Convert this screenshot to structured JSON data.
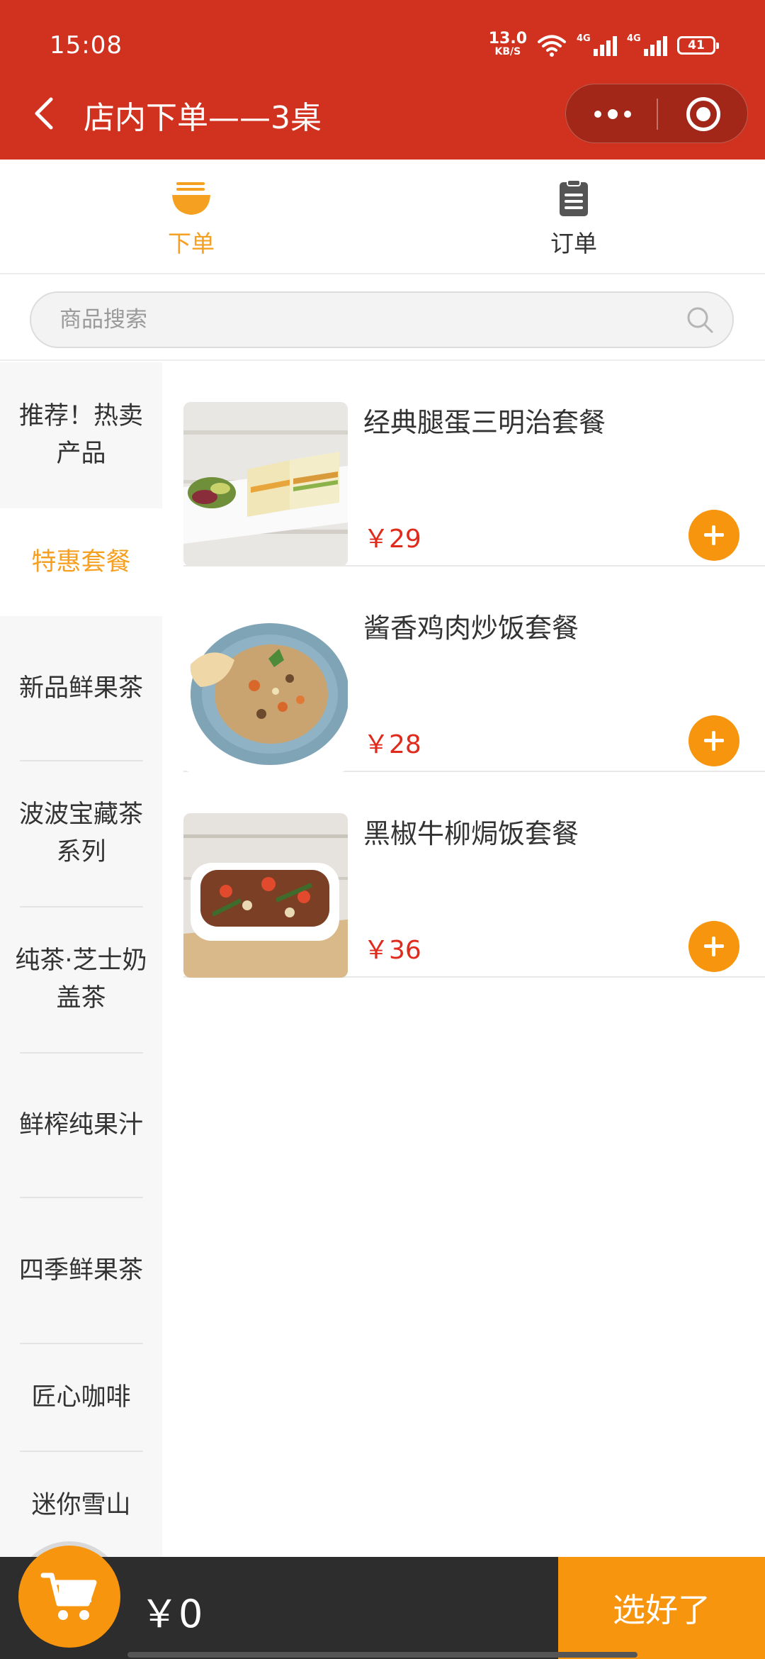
{
  "status_bar": {
    "time": "15:08",
    "net_speed_value": "13.0",
    "net_speed_unit": "KB/S",
    "sim1": "4G",
    "sim2": "4G",
    "battery": "41"
  },
  "header": {
    "title": "店内下单——3桌",
    "colors": {
      "bar": "#D0321F"
    }
  },
  "tabs": [
    {
      "label": "下单",
      "icon": "bowl-icon",
      "active": true
    },
    {
      "label": "订单",
      "icon": "clipboard-icon",
      "active": false
    }
  ],
  "search": {
    "placeholder": "商品搜索",
    "value": ""
  },
  "categories": [
    {
      "label": "推荐！热卖产品"
    },
    {
      "label": "特惠套餐",
      "active": true
    },
    {
      "label": "新品鲜果茶"
    },
    {
      "label": "波波宝藏茶系列"
    },
    {
      "label": "纯茶·芝士奶盖茶"
    },
    {
      "label": "鲜榨纯果汁"
    },
    {
      "label": "四季鲜果茶"
    },
    {
      "label": "匠心咖啡"
    },
    {
      "label": "迷你雪山"
    }
  ],
  "products": [
    {
      "name": "经典腿蛋三明治套餐",
      "price": "￥29"
    },
    {
      "name": "酱香鸡肉炒饭套餐",
      "price": "￥28"
    },
    {
      "name": "黑椒牛柳焗饭套餐",
      "price": "￥36"
    }
  ],
  "cart": {
    "total": "￥0",
    "confirm_label": "选好了"
  },
  "colors": {
    "accent": "#F7950E",
    "active_text": "#F5A020",
    "price": "#E02A1C",
    "bottom_bar": "#2d2d2d"
  }
}
